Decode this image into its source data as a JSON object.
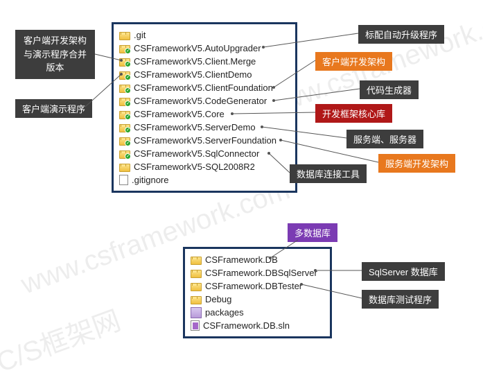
{
  "watermarks": [
    "www.csframework.com",
    "www.csframework.com",
    "C/S框架网"
  ],
  "panel1": {
    "items": [
      {
        "name": ".git",
        "type": "folder",
        "badge": false
      },
      {
        "name": "CSFrameworkV5.AutoUpgrader",
        "type": "folder",
        "badge": true
      },
      {
        "name": "CSFrameworkV5.Client.Merge",
        "type": "folder",
        "badge": true
      },
      {
        "name": "CSFrameworkV5.ClientDemo",
        "type": "folder",
        "badge": true
      },
      {
        "name": "CSFrameworkV5.ClientFoundation",
        "type": "folder",
        "badge": true
      },
      {
        "name": "CSFrameworkV5.CodeGenerator",
        "type": "folder",
        "badge": true
      },
      {
        "name": "CSFrameworkV5.Core",
        "type": "folder",
        "badge": true
      },
      {
        "name": "CSFrameworkV5.ServerDemo",
        "type": "folder",
        "badge": true
      },
      {
        "name": "CSFrameworkV5.ServerFoundation",
        "type": "folder",
        "badge": true
      },
      {
        "name": "CSFrameworkV5.SqlConnector",
        "type": "folder",
        "badge": true
      },
      {
        "name": "CSFrameworkV5-SQL2008R2",
        "type": "folder",
        "badge": false
      },
      {
        "name": ".gitignore",
        "type": "file-ign",
        "badge": false
      }
    ]
  },
  "panel2": {
    "items": [
      {
        "name": "CSFramework.DB",
        "type": "folder",
        "badge": false
      },
      {
        "name": "CSFramework.DBSqlServer",
        "type": "folder",
        "badge": false
      },
      {
        "name": "CSFramework.DBTester",
        "type": "folder",
        "badge": false
      },
      {
        "name": "Debug",
        "type": "folder",
        "badge": false
      },
      {
        "name": "packages",
        "type": "pkg",
        "badge": false
      },
      {
        "name": "CSFramework.DB.sln",
        "type": "file-sln",
        "badge": false
      }
    ]
  },
  "labels": {
    "l1a": "客户端开发架构",
    "l1b": "与演示程序合并",
    "l1c": "版本",
    "l2": "客户端演示程序",
    "r1": "标配自动升级程序",
    "r2": "客户端开发架构",
    "r3": "代码生成器",
    "r4": "开发框架核心库",
    "r5": "服务端、服务器",
    "r6": "服务端开发架构",
    "r7": "数据库连接工具",
    "p1": "多数据库",
    "p2": "SqlServer 数据库",
    "p3": "数据库测试程序"
  }
}
